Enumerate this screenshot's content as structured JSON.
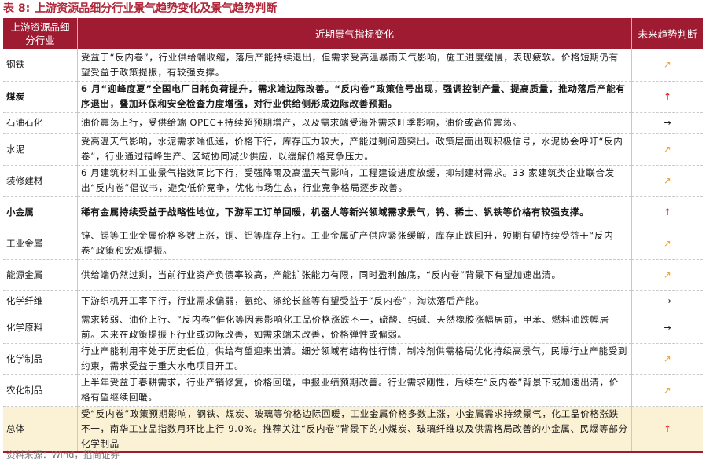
{
  "caption": {
    "label": "表 8:",
    "title": "上游资源品细分行业景气趋势变化及景气趋势判断"
  },
  "header": {
    "col1": "上游资源品细分行业",
    "col2": "近期景气指标变化",
    "col3": "未来趋势判断"
  },
  "rows": [
    {
      "industry": "钢铁",
      "change": "受益于“反内卷”，行业供给端收缩，落后产能持续退出，但需求受高温暴雨天气影响，施工进度缓慢，表现疲软。价格短期仍有望受益于政策提振，有较强支撑。",
      "trend": "↗"
    },
    {
      "industry": "煤炭",
      "change": "6 月“迎峰度夏”全国电厂日耗负荷提升，需求端边际改善。“反内卷”政策信号出现，强调控制产量、提高质量，推动落后产能有序退出，叠加环保和安全检查力度增强，对行业供给侧形成边际改善预期。",
      "trend": "↑"
    },
    {
      "industry": "石油石化",
      "change": "油价震荡上行，受供给端 OPEC+持续超预期增产，以及需求端受海外需求旺季影响，油价或高位震荡。",
      "trend": "→"
    },
    {
      "industry": "水泥",
      "change": "受高温天气影响，水泥需求端低迷，价格下行，库存压力较大，产能过剩问题突出。政策层面出现积极信号，水泥协会呼吁“反内卷”，行业通过错峰生产、区域协同减少供应，以缓解价格竞争压力。",
      "trend": "↗"
    },
    {
      "industry": "装修建材",
      "change": "6 月建筑材料工业景气指数同比下行，受强降雨及高温天气影响，工程建设进度放缓，抑制建材需求。33 家建筑类企业联合发出“反内卷”倡议书，避免低价竞争，优化市场生态，行业竞争格局逐步改善。",
      "trend": "↗"
    },
    {
      "industry": "小金属",
      "change": "稀有金属持续受益于战略性地位，下游军工订单回暖，机器人等新兴领域需求景气，钨、稀土、钒铁等价格有较强支撑。",
      "trend": "↑"
    },
    {
      "industry": "工业金属",
      "change": "锌、锡等工业金属价格多数上涨，铜、铝等库存上行。工业金属矿产供应紧张缓解，库存止跌回升，短期有望持续受益于“反内卷”政策和宏观提振。",
      "trend": "↗"
    },
    {
      "industry": "能源金属",
      "change": "供给端仍然过剩，当前行业资产负债率较高，产能扩张能力有限，同时盈利触底，“反内卷”背景下有望加速出清。",
      "trend": "↗"
    },
    {
      "industry": "化学纤维",
      "change": "下游织机开工率下行，行业需求偏弱，氨纶、涤纶长丝等有望受益于“反内卷”，淘汰落后产能。",
      "trend": "→"
    },
    {
      "industry": "化学原料",
      "change": "需求转弱、油价上行、“反内卷”催化等因素影响化工品价格涨跌不一，硫酸、纯碱、天然橡胶涨幅居前，甲苯、燃料油跌幅居前。未来在政策提振下行业或边际改善，如需求端未改善，价格弹性或偏弱。",
      "trend": "→"
    },
    {
      "industry": "化学制品",
      "change": "行业产能利用率处于历史低位，供给有望迎来出清。细分领域有结构性行情，制冷剂供需格局优化持续高景气，民爆行业产能受到约束，需求受益于重大水电项目开工。",
      "trend": "↗"
    },
    {
      "industry": "农化制品",
      "change": "上半年受益于春耕需求，行业产销修复，价格回暖，中报业绩预期改善。行业需求刚性，后续在“反内卷”背景下或加速出清，价格有望继续回暖。",
      "trend": "↗"
    },
    {
      "industry": "总体",
      "change": "受“反内卷”政策预期影响，钢铁、煤炭、玻璃等价格边际回暖，工业金属价格多数上涨，小金属需求持续景气，化工品价格涨跌不一，南华工业品指数月环比上行 9.0%。推荐关注“反内卷”背景下的小煤炭、玻璃纤维以及供需格局改善的小金属、民爆等部分化学制品",
      "trend": "↑"
    }
  ],
  "source": "资料来源：Wind，招商证券",
  "colors": {
    "header_bg": "#9e1b32",
    "title": "#b0283a",
    "up": "#e02020",
    "up_right": "#f0a020",
    "total_bg": "#fbf1d4"
  },
  "icons": {
    "up": "arrow-up-icon",
    "up_right": "arrow-up-right-icon",
    "flat": "arrow-right-icon"
  }
}
